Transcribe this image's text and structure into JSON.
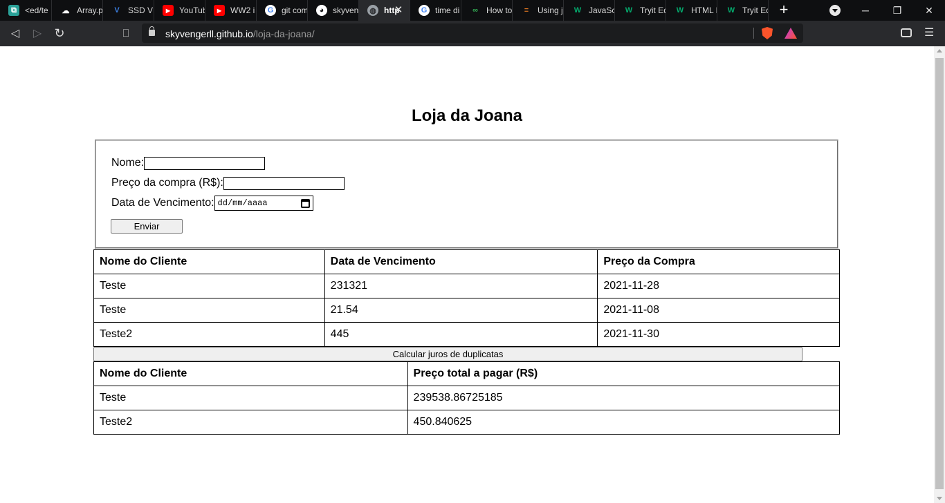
{
  "browser": {
    "tabs": [
      {
        "title": "<ed/te",
        "icon": "editor-icon",
        "color": "#2aa198"
      },
      {
        "title": "Array.p",
        "icon": "cloud-icon",
        "color": "#ffffff"
      },
      {
        "title": "SSD VF",
        "icon": "v-icon",
        "color": "#3b7ddd"
      },
      {
        "title": "YouTub",
        "icon": "youtube-icon",
        "color": "#ff0000"
      },
      {
        "title": "WW2 i",
        "icon": "youtube-icon",
        "color": "#ff0000"
      },
      {
        "title": "git com",
        "icon": "google-icon",
        "color": "#4285f4"
      },
      {
        "title": "skyven",
        "icon": "github-icon",
        "color": "#ffffff"
      },
      {
        "title": "http",
        "icon": "globe-icon",
        "color": "#9aa0a6"
      },
      {
        "title": "time di",
        "icon": "google-icon",
        "color": "#4285f4"
      },
      {
        "title": "How to",
        "icon": "infinity-icon",
        "color": "#32a852"
      },
      {
        "title": "Using j",
        "icon": "stackoverflow-icon",
        "color": "#f48024"
      },
      {
        "title": "JavaScr",
        "icon": "w3-icon",
        "color": "#04aa6d"
      },
      {
        "title": "Tryit Ed",
        "icon": "w3-icon",
        "color": "#04aa6d"
      },
      {
        "title": "HTML I",
        "icon": "w3-icon",
        "color": "#04aa6d"
      },
      {
        "title": "Tryit Ed",
        "icon": "w3-icon",
        "color": "#04aa6d"
      }
    ],
    "url_host": "skyvengerll.github.io",
    "url_path": "/loja-da-joana/"
  },
  "page": {
    "title": "Loja da Joana",
    "form": {
      "name_label": "Nome:",
      "name_value": "",
      "price_label": "Preço da compra (R$):",
      "price_value": "",
      "date_label": "Data de Vencimento:",
      "date_placeholder": "dd/mm/aaaa",
      "submit_label": "Enviar"
    },
    "purchases_table": {
      "headers": [
        "Nome do Cliente",
        "Data de Vencimento",
        "Preço da Compra"
      ],
      "rows": [
        [
          "Teste",
          "231321",
          "2021-11-28"
        ],
        [
          "Teste",
          "21.54",
          "2021-11-08"
        ],
        [
          "Teste2",
          "445",
          "2021-11-30"
        ]
      ]
    },
    "calc_button_label": "Calcular juros de duplicatas",
    "totals_table": {
      "headers": [
        "Nome do Cliente",
        "Preço total a pagar (R$)"
      ],
      "rows": [
        [
          "Teste",
          "239538.86725185"
        ],
        [
          "Teste2",
          "450.840625"
        ]
      ]
    }
  }
}
